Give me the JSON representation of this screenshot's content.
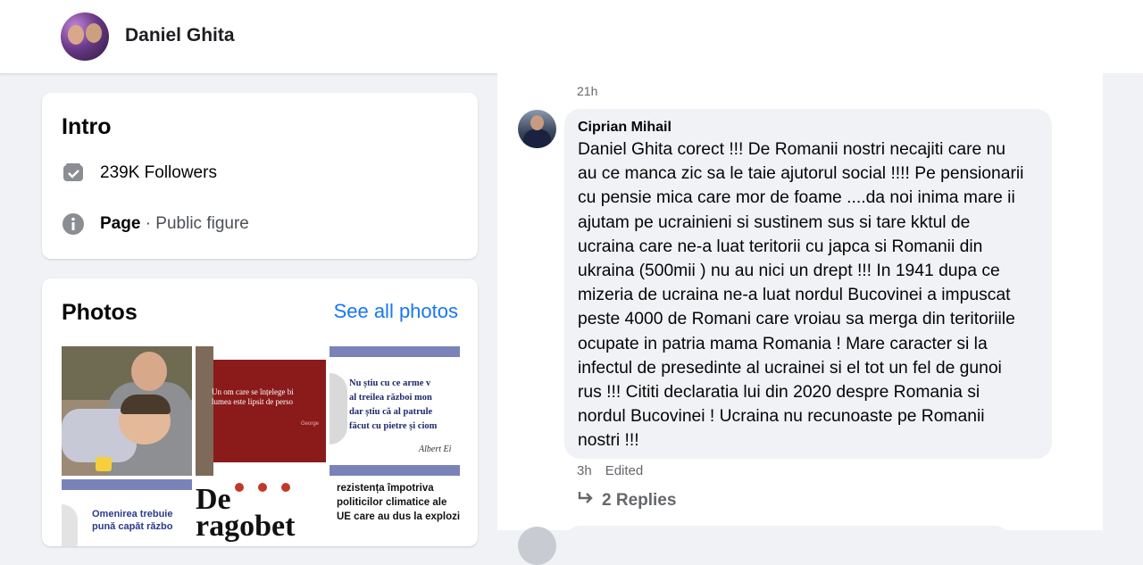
{
  "header": {
    "page_name": "Daniel Ghita"
  },
  "intro": {
    "title": "Intro",
    "followers": "239K Followers",
    "page_label": "Page",
    "page_category": " · Public figure"
  },
  "photos": {
    "title": "Photos",
    "see_all": "See all photos",
    "tile2_quote": [
      "Un om care se înțelege bi",
      "lumea este lipsit de perso"
    ],
    "tile2_author": "George",
    "tile3_quote": [
      "Nu știu cu ce arme v",
      "al treilea război mon",
      "dar știu că al patrule",
      "făcut cu pietre și ciom"
    ],
    "tile3_author": "Albert Ei",
    "tile4_quote": [
      "Omenirea trebuie",
      "pună capăt războ"
    ],
    "tile5_text": [
      "De",
      "ragobet"
    ],
    "tile6_quote": [
      "rezistența împotriva",
      "politicilor climatice ale",
      "UE care au dus la explozia"
    ]
  },
  "post": {
    "time_top": "21h"
  },
  "comment": {
    "author": "Ciprian Mihail",
    "text": "Daniel Ghita corect !!! De Romanii nostri necajiti care nu\nau ce manca zic sa le taie ajutorul social !!!! Pe pensionarii\ncu pensie mica care mor de foame ....da noi inima mare ii\najutam pe ucrainieni si sustinem sus si tare kktul de\nucraina care ne-a luat teritorii cu japca si Romanii din\nukraina (500mii ) nu au nici un drept !!! In 1941 dupa ce\nmizeria de ucraina ne-a luat nordul Bucovinei a impuscat\npeste 4000 de Romani care vroiau sa merga din teritoriile\nocupate in patria mama Romania ! Mare caracter si la\ninfectul de presedinte al ucrainei si el tot un fel de gunoi\nrus !!! Cititi declaratia lui din 2020 despre Romania si\nnordul Bucovinei ! Ucraina nu recunoaste pe Romanii\nnostri !!!",
    "time": "3h",
    "edited": "Edited",
    "replies": "2 Replies"
  },
  "icons": {
    "followers": "followers-icon",
    "info": "info-icon",
    "reply": "reply-arrow-icon"
  },
  "colors": {
    "link": "#1877f2",
    "muted": "#65676b",
    "bubble": "#f0f2f5",
    "background": "#f0f2f5"
  }
}
